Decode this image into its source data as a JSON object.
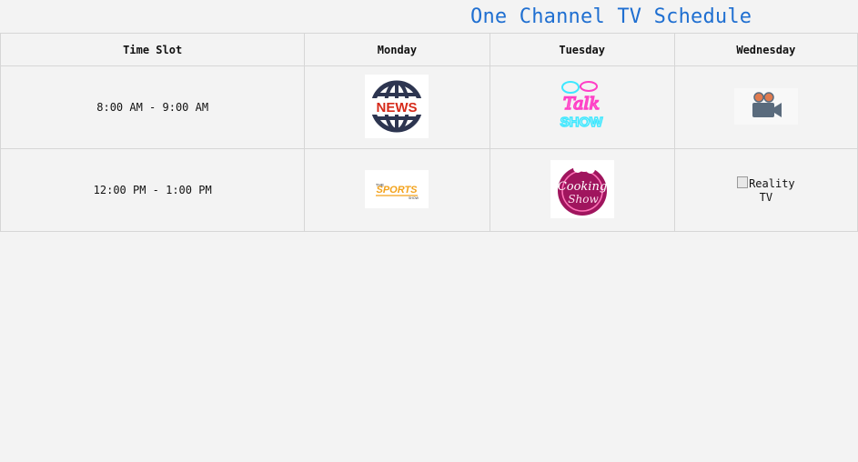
{
  "page": {
    "title": "One Channel TV Schedule"
  },
  "table": {
    "headers": [
      "Time Slot",
      "Monday",
      "Tuesday",
      "Wednesday"
    ],
    "rows": [
      {
        "time": "8:00 AM - 9:00 AM",
        "monday": {
          "logo_icon": "news-logo-icon",
          "text": "NEWS"
        },
        "tuesday": {
          "logo_icon": "talk-show-logo-icon",
          "line1": "Talk",
          "line2": "SHOW"
        },
        "wednesday": {
          "logo_icon": "movie-camera-icon"
        }
      },
      {
        "time": "12:00 PM - 1:00 PM",
        "monday": {
          "logo_icon": "sports-logo-icon",
          "small": "THE",
          "text": "SPORTS",
          "sub": "SHOW"
        },
        "tuesday": {
          "logo_icon": "cooking-show-logo-icon",
          "line1": "Cooking",
          "line2": "Show"
        },
        "wednesday": {
          "broken_image_alt": "Reality TV"
        }
      }
    ]
  },
  "colors": {
    "title": "#1f6fd1",
    "background": "#f3f3f3",
    "news_red": "#d62a1a",
    "news_navy": "#2d3550",
    "sports_orange": "#f3a21b",
    "talk_cyan": "#3ee8ff",
    "talk_pink": "#ff3fc6",
    "cooking_magenta": "#a0155e"
  }
}
